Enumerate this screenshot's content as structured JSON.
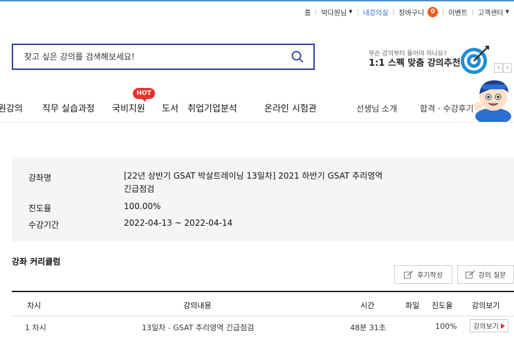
{
  "utility": {
    "home": "홈",
    "user": "박다원님",
    "my_class": "내강의실",
    "cart": "장바구니",
    "cart_count": "0",
    "event": "이벤트",
    "support": "고객센터"
  },
  "search": {
    "placeholder": "찾고 싶은 강의를 검색해보세요!"
  },
  "promo": {
    "small": "무슨 강의부터 들어야 하나요?",
    "big": "1:1 스펙 맞춤 강의추천"
  },
  "nav": {
    "items": [
      "원강의",
      "직무 실습과정",
      "국비지원",
      "도서",
      "취업기업분석",
      "온라인 시험관"
    ],
    "hot_badge": "HOT",
    "right_items": [
      "선생님 소개",
      "합격 · 수강후기"
    ]
  },
  "course_info": {
    "name_label": "강좌명",
    "name_line1": "[22년 상반기 GSAT 박살트레이닝 13일차] 2021 하반기 GSAT 추리영역",
    "name_line2": "긴급점검",
    "progress_label": "진도율",
    "progress_value": "100.00%",
    "period_label": "수강기간",
    "period_value": "2022-04-13 ~ 2022-04-14"
  },
  "curriculum": {
    "title": "강좌 커리큘럼",
    "review_button": "후기작성",
    "question_button": "강의 질문",
    "headers": [
      "차시",
      "강의내용",
      "시간",
      "파일",
      "진도율",
      "강의보기"
    ],
    "rows": [
      {
        "chapter": "1 차시",
        "content": "13일차 - GSAT 추리영역 긴급점검",
        "time": "48분 31초",
        "file": "",
        "progress": "100%",
        "view": "강의보기"
      }
    ]
  },
  "colors": {
    "accent": "#2f3e9e",
    "badge": "#f05a1a",
    "hot": "#e8322e",
    "active_link": "#2d6bd1"
  }
}
